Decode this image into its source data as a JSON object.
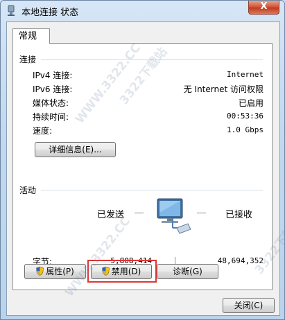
{
  "window": {
    "title": "本地连接 状态",
    "close_label": "X"
  },
  "tabs": [
    {
      "label": "常规"
    }
  ],
  "connection": {
    "section_title": "连接",
    "rows": [
      {
        "label": "IPv4 连接:",
        "value": "Internet"
      },
      {
        "label": "IPv6 连接:",
        "value": "无 Internet 访问权限"
      },
      {
        "label": "媒体状态:",
        "value": "已启用"
      },
      {
        "label": "持续时间:",
        "value": "00:53:36"
      },
      {
        "label": "速度:",
        "value": "1.0 Gbps"
      }
    ],
    "details_button": "详细信息(E)..."
  },
  "activity": {
    "section_title": "活动",
    "sent_label": "已发送",
    "received_label": "已接收",
    "bytes_label": "字节:",
    "bytes_sent": "5,808,414",
    "bytes_received": "48,694,352"
  },
  "buttons": {
    "properties": "属性(P)",
    "disable": "禁用(D)",
    "diagnose": "诊断(G)",
    "close": "关闭(C)"
  },
  "watermarks": [
    "WWW.3322.CC",
    "3322下载站",
    "WWW.3322.CC",
    "3322下载站"
  ],
  "colors": {
    "highlight_box": "#e03434",
    "title_bar": "#c2d9ef"
  },
  "icons": [
    "network-adapter-icon",
    "network-computer-icon",
    "shield-icon"
  ]
}
